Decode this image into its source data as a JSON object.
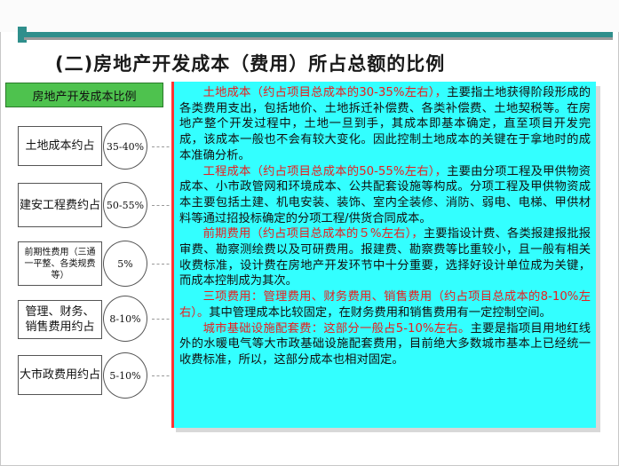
{
  "title": "(二)房地产开发成本（费用）所占总额的比例",
  "left_header": "房地产开发成本比例",
  "categories": [
    {
      "label": "土地成本约占",
      "pct": "35-40%"
    },
    {
      "label": "建安工程费约占",
      "pct": "50-55%"
    },
    {
      "label": "前期性费用（三通一平整、各类规费等）",
      "pct": "5%"
    },
    {
      "label": "管理、财务、销售费用约占",
      "pct": "8-10%"
    },
    {
      "label": "大市政费用约占",
      "pct": "5-10%"
    }
  ],
  "paragraphs": [
    {
      "lead": "土地成本（约占项目总成本的30-35%左右），",
      "body": "主要指土地获得阶段形成的各类费用支出，包括地价、土地拆迁补偿费、各类补偿费、土地契税等。在房地产整个开发过程中，土地一旦到手，其成本即基本确定，直至项目开发完成，该成本一般也不会有较大变化。因此控制土地成本的关键在于拿地时的成本准确分析。"
    },
    {
      "lead": "工程成本（约占项目总成本的50-55%左右），",
      "body": "主要由分项工程及甲供物资成本、小市政管网和环境成本、公共配套设施等构成。分项工程及甲供物资成本主要包括土建、机电安装、装饰、室内全装修、消防、弱电、电梯、甲供材料等通过招投标确定的分项工程/供货合同成本。"
    },
    {
      "lead": "前期费用（约占项目总成本的５%左右），",
      "body": "主要指设计费、各类报建报批报审费、勘察测绘费以及可研费用。报建费、勘察费等比重较小，且一般有相关收费标准，设计费在房地产开发环节中十分重要，选择好设计单位成为关键，而成本控制成为其次。"
    },
    {
      "lead": "三项费用：管理费用、财务费用、销售费用（约占项目总成本的8-10%左右）。",
      "body": "其中管理成本比较固定，在财务费用和销售费用有一定控制空间。"
    },
    {
      "lead": "城市基础设施配套费：这部分一般占5-10%左右。",
      "body": "主要是指项目用地红线外的水暖电气等大市政基础设施配套费用，目前绝大多数城市基本上已经统一收费标准，所以，这部分成本也相对固定。"
    }
  ],
  "colors": {
    "panel": "#33ffff",
    "highlight": "#e62020",
    "header_green": "#4ec24e",
    "stripe": "#2f8f8c"
  }
}
